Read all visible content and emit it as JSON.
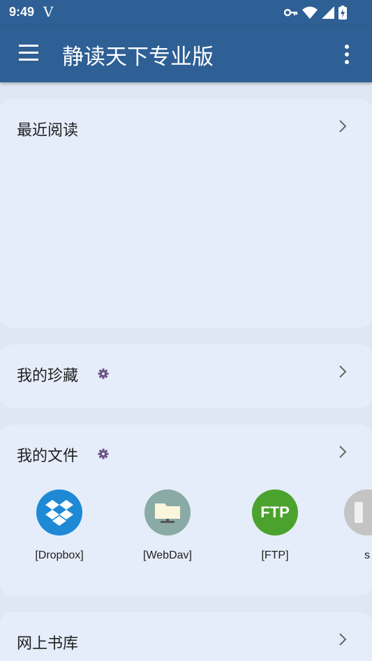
{
  "status_bar": {
    "time": "9:49",
    "carrier_glyph": "V",
    "icons": [
      "key-icon",
      "wifi-icon",
      "signal-icon",
      "battery-charging-icon"
    ]
  },
  "app_bar": {
    "title": "静读天下专业版",
    "left_icon": "hamburger-menu-icon",
    "right_icon": "more-vert-icon",
    "color": "#2e5f95"
  },
  "sections": {
    "recent": {
      "title": "最近阅读"
    },
    "favorites": {
      "title": "我的珍藏"
    },
    "files": {
      "title": "我的文件",
      "items": [
        {
          "label": "[Dropbox]",
          "icon": "dropbox-icon",
          "color": "#1e8ad6"
        },
        {
          "label": "[WebDav]",
          "icon": "webdav-folder-icon",
          "color": "#8aaaa5"
        },
        {
          "label": "[FTP]",
          "icon": "ftp-icon",
          "icon_text": "FTP",
          "color": "#4ba32d"
        },
        {
          "label": "s",
          "icon": "storage-icon",
          "color": "#c4c4c4"
        }
      ]
    },
    "online_library": {
      "title": "网上书库"
    }
  },
  "colors": {
    "background": "#dfe7f4",
    "card": "#e5edfa",
    "gear_accent": "#6a5283"
  }
}
